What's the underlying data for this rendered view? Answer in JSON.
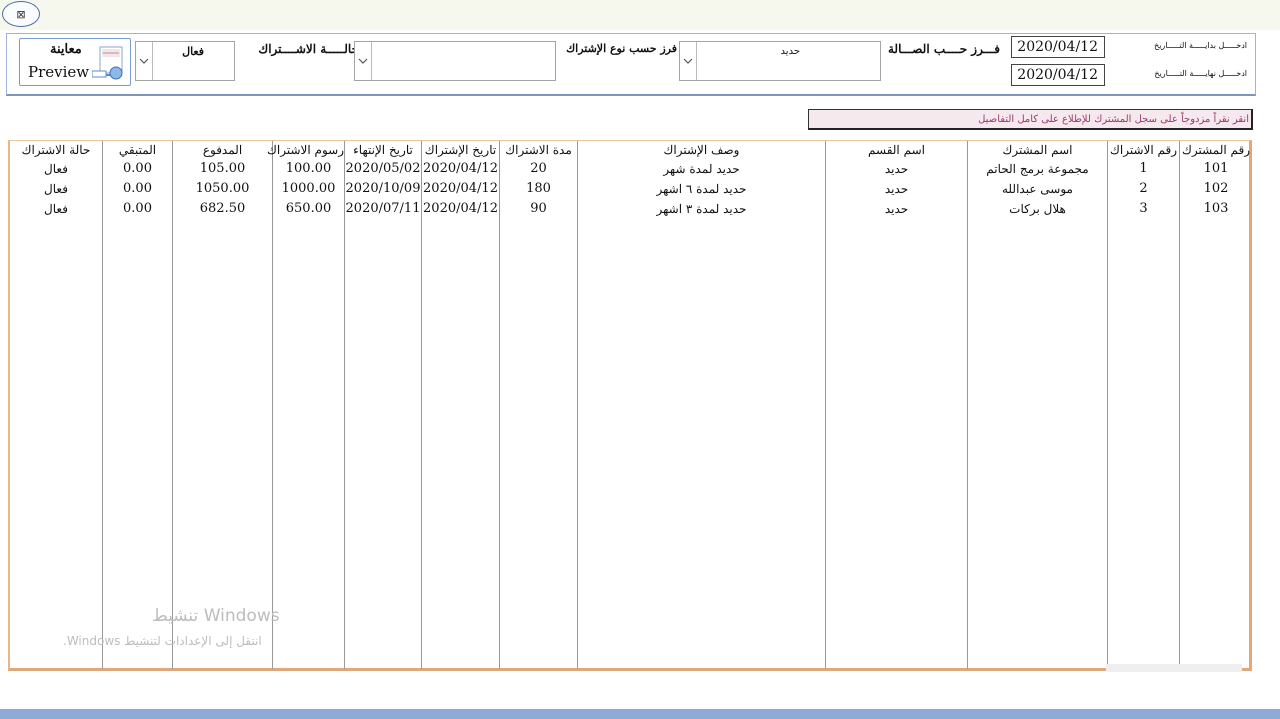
{
  "window": {
    "close_label": "⊠"
  },
  "filters": {
    "preview_label_ar": "معاينة",
    "preview_label_en": "Preview",
    "status_label": "حالـــــة الاشــــتراك",
    "status_value": "فعال",
    "type_label": "فرز حسب نوع الإشتراك",
    "type_value": "",
    "hall_label": "فـــرز حــــب الصـــالة",
    "hall_value": "حديد",
    "start_date_label": "ادخـــــل بدايـــــة التـــــاريخ",
    "start_date_value": "2020/04/12",
    "end_date_label": "ادخـــــل نهايـــــة التـــــاريخ",
    "end_date_value": "2020/04/12"
  },
  "hint": "انقر نقراً مزدوجاً على سجل المشترك للإطلاع على كامل التفاصيل",
  "table": {
    "headers": {
      "member_no": "رقم المشترك",
      "sub_no": "رقم الاشتراك",
      "member_name": "اسم المشترك",
      "section": "اسم القسم",
      "desc": "وصف الإشتراك",
      "duration": "مدة الاشتراك",
      "start": "تاريخ الإشتراك",
      "end": "تاريخ الإنتهاء",
      "fee": "رسوم الاشتراك",
      "paid": "المدفوع",
      "remaining": "المتبقي",
      "status": "حالة الاشتراك"
    },
    "rows": [
      {
        "member_no": "101",
        "sub_no": "1",
        "member_name": "مجموعة برمج الحاتم",
        "section": "حديد",
        "desc": "حديد لمدة شهر",
        "duration": "20",
        "start": "2020/04/12",
        "end": "2020/05/02",
        "fee": "100.00",
        "paid": "105.00",
        "remaining": "0.00",
        "status": "فعال"
      },
      {
        "member_no": "102",
        "sub_no": "2",
        "member_name": "موسى عبدالله",
        "section": "حديد",
        "desc": "حديد لمدة ٦ اشهر",
        "duration": "180",
        "start": "2020/04/12",
        "end": "2020/10/09",
        "fee": "1000.00",
        "paid": "1050.00",
        "remaining": "0.00",
        "status": "فعال"
      },
      {
        "member_no": "103",
        "sub_no": "3",
        "member_name": "هلال بركات",
        "section": "حديد",
        "desc": "حديد لمدة ٣ اشهر",
        "duration": "90",
        "start": "2020/04/12",
        "end": "2020/07/11",
        "fee": "650.00",
        "paid": "682.50",
        "remaining": "0.00",
        "status": "فعال"
      }
    ]
  },
  "watermark": {
    "line1": "تنشيط Windows",
    "line2": "انتقل إلى الإعدادات لتنشيط Windows."
  }
}
